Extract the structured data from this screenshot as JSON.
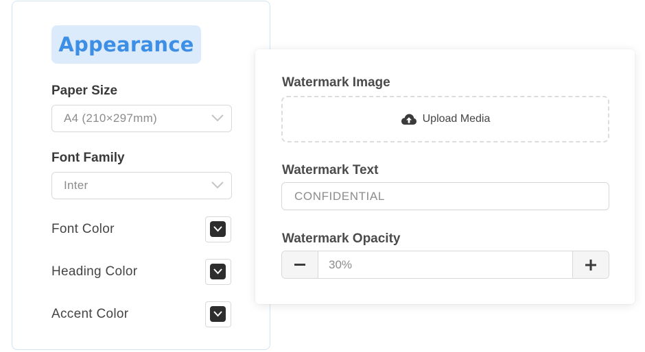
{
  "appearance": {
    "title": "Appearance",
    "paper_size": {
      "label": "Paper Size",
      "value": "A4 (210×297mm)"
    },
    "font_family": {
      "label": "Font Family",
      "value": "Inter"
    },
    "colors": [
      {
        "label": "Font Color",
        "swatch": "#2d2d2d"
      },
      {
        "label": "Heading Color",
        "swatch": "#2d2d2d"
      },
      {
        "label": "Accent Color",
        "swatch": "#2d2d2d"
      }
    ]
  },
  "watermark": {
    "image_label": "Watermark Image",
    "upload_label": "Upload Media",
    "text_label": "Watermark Text",
    "text_value": "CONFIDENTIAL",
    "opacity_label": "Watermark Opacity",
    "opacity_value": "30%",
    "minus_icon": "minus-icon",
    "plus_icon": "plus-icon"
  },
  "colors": {
    "accent": "#3d8fe6",
    "accent_bg": "#dcebfb",
    "panel_border": "#cfe6f7"
  }
}
